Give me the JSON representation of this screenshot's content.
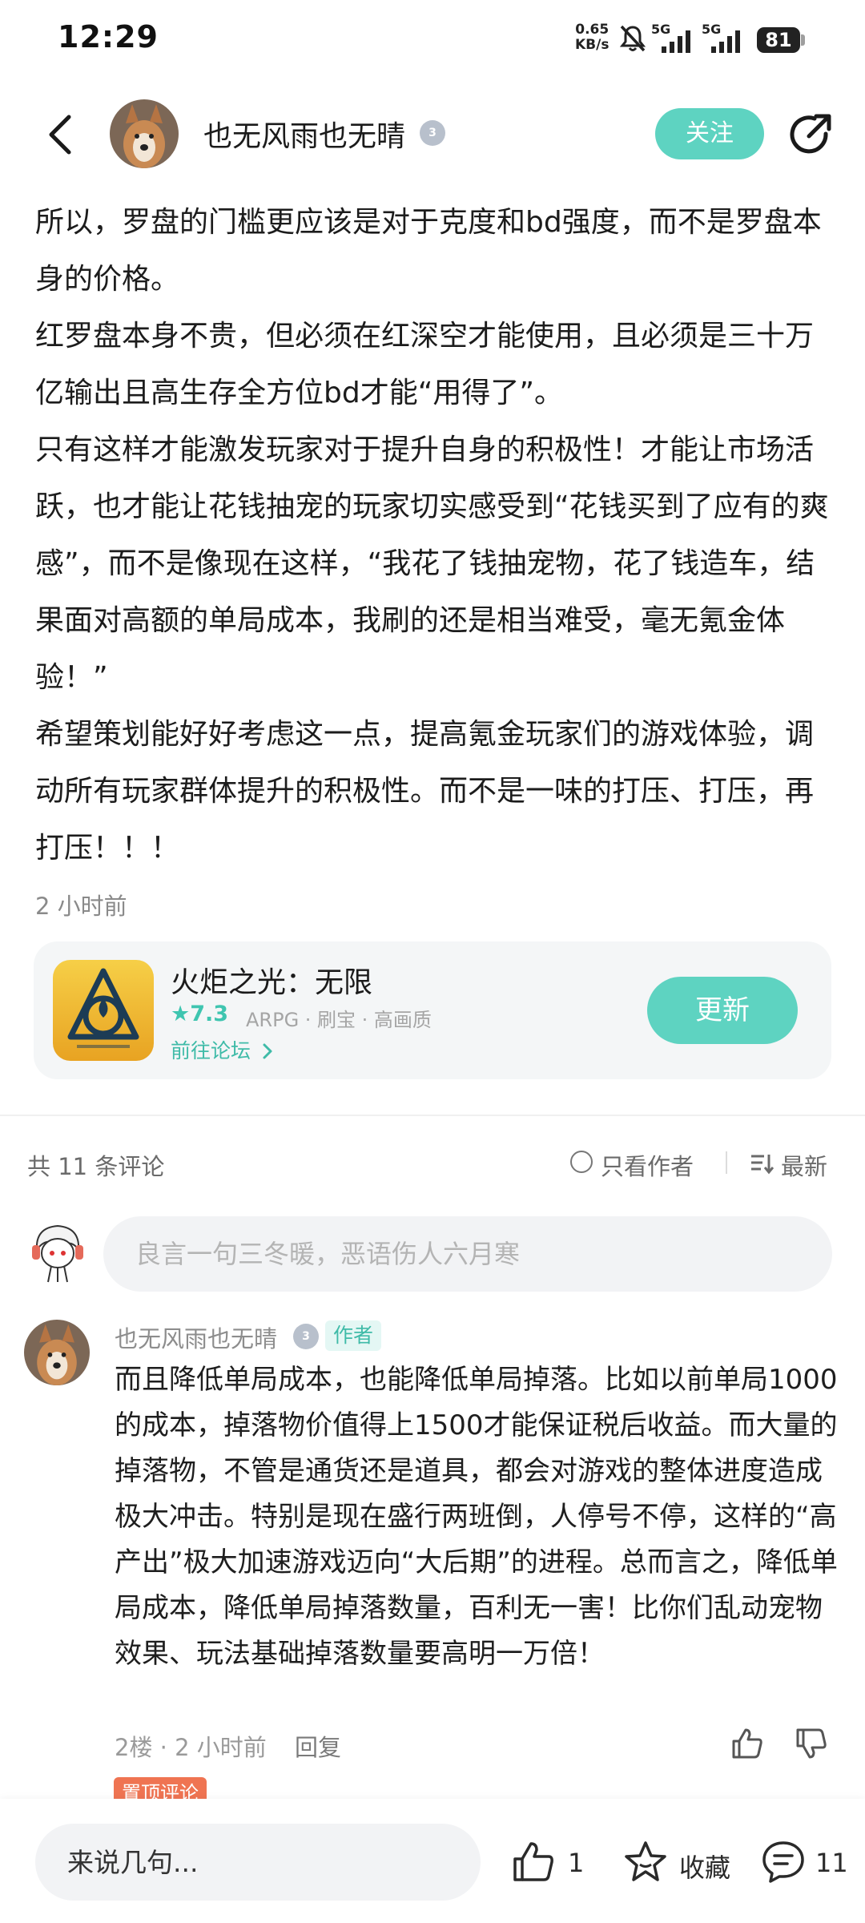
{
  "status_bar": {
    "time": "12:29",
    "net_speed_value": "0.65",
    "net_speed_unit": "KB/s",
    "signal_1": "5G",
    "signal_2": "5G",
    "battery": "81"
  },
  "header": {
    "author_name": "也无风雨也无晴",
    "level": "3",
    "follow_label": "关注"
  },
  "post": {
    "paragraphs": [
      "所以，罗盘的门槛更应该是对于克度和bd强度，而不是罗盘本身的价格。",
      "红罗盘本身不贵，但必须在红深空才能使用，且必须是三十万亿输出且高生存全方位bd才能“用得了”。",
      "只有这样才能激发玩家对于提升自身的积极性！才能让市场活跃，也才能让花钱抽宠的玩家切实感受到“花钱买到了应有的爽感”，而不是像现在这样，“我花了钱抽宠物，花了钱造车，结果面对高额的单局成本，我刷的还是相当难受，毫无氪金体验！”",
      "希望策划能好好考虑这一点，提高氪金玩家们的游戏体验，调动所有玩家群体提升的积极性。而不是一味的打压、打压，再打压！！！"
    ],
    "time": "2 小时前"
  },
  "game_card": {
    "name": "火炬之光：无限",
    "rating": "7.3",
    "tags": "ARPG · 刷宝 · 高画质",
    "forum_link": "前往论坛",
    "button": "更新"
  },
  "comments_header": {
    "count": "共 11 条评论",
    "only_author": "只看作者",
    "sort": "最新"
  },
  "comment_input": {
    "placeholder": "良言一句三冬暖，恶语伤人六月寒"
  },
  "comment": {
    "author": "也无风雨也无晴",
    "level": "3",
    "author_tag": "作者",
    "text": "而且降低单局成本，也能降低单局掉落。比如以前单局1000的成本，掉落物价值得上1500才能保证税后收益。而大量的掉落物，不管是通货还是道具，都会对游戏的整体进度造成极大冲击。特别是现在盛行两班倒，人停号不停，这样的“高产出”极大加速游戏迈向“大后期”的进程。总而言之，降低单局成本，降低单局掉落数量，百利无一害！比你们乱动宠物效果、玩法基础掉落数量要高明一万倍！",
    "meta": "2楼 · 2 小时前",
    "reply": "回复",
    "pinned_tag": "置顶评论"
  },
  "bottom_bar": {
    "placeholder": "来说几句...",
    "like_count": "1",
    "favorite_label": "收藏",
    "comment_count": "11"
  },
  "colors": {
    "accent": "#5ed3c1",
    "accent_text": "#3fbba8",
    "pinned": "#ef7452"
  }
}
